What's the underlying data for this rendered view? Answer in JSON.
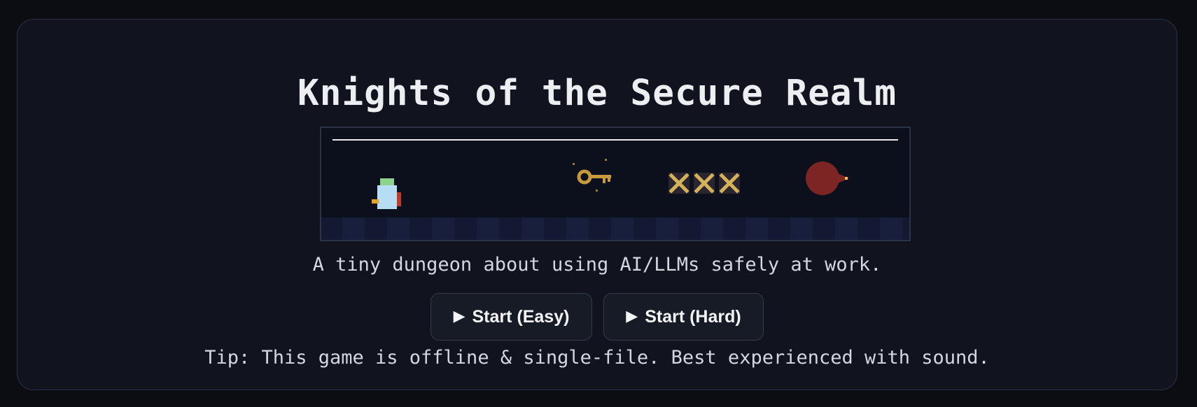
{
  "title": "Knights of the Secure Realm",
  "subtitle": "A tiny dungeon about using AI/LLMs safely at work.",
  "buttons": {
    "easy": {
      "icon": "play-icon",
      "glyph": "▶",
      "label": "Start (Easy)"
    },
    "hard": {
      "icon": "play-icon",
      "glyph": "▶",
      "label": "Start (Hard)"
    }
  },
  "tip": "Tip: This game is offline & single-file. Best experienced with sound.",
  "preview": {
    "sprites": [
      "knight-sprite",
      "golden-key-sprite",
      "spike-trap-sprite",
      "red-slime-enemy-sprite"
    ],
    "spike_count": 3
  },
  "colors": {
    "page_bg": "#0b0d13",
    "card_bg": "#11141f",
    "preview_bg": "#0c101c",
    "knight_body": "#b7ddf5",
    "knight_helmet": "#8ed38b",
    "key": "#c99a3c",
    "enemy": "#7d2424"
  }
}
